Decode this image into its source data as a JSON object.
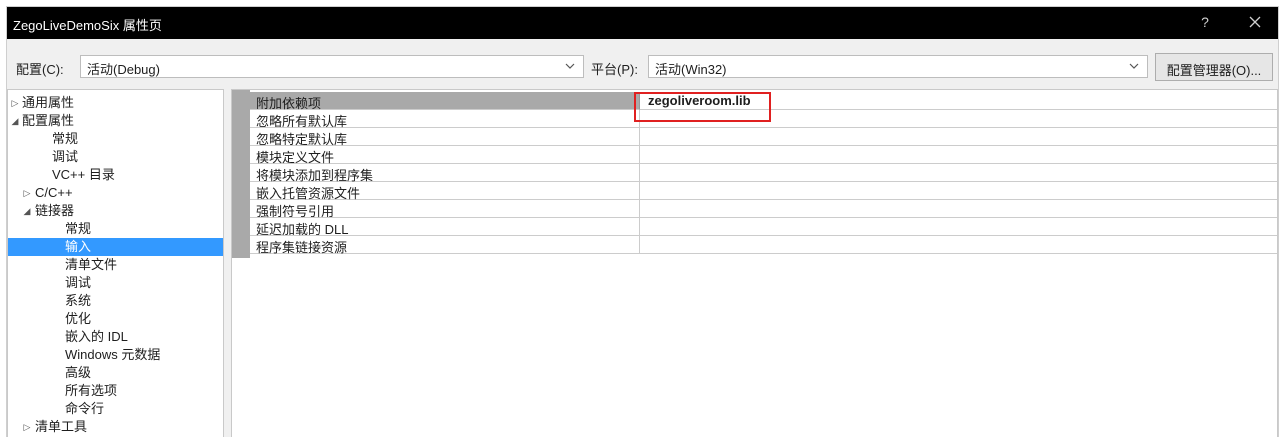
{
  "window": {
    "title": "ZegoLiveDemoSix 属性页",
    "help_label": "?",
    "close_icon": "close-icon"
  },
  "toolbar": {
    "config_label": "配置(C):",
    "config_value": "活动(Debug)",
    "platform_label": "平台(P):",
    "platform_value": "活动(Win32)",
    "config_manager_label": "配置管理器(O)..."
  },
  "tree": {
    "items": [
      {
        "label": "通用属性",
        "arrow": "▷"
      },
      {
        "label": "配置属性",
        "arrow": "◢"
      },
      {
        "label": "常规"
      },
      {
        "label": "调试"
      },
      {
        "label": "VC++ 目录"
      },
      {
        "label": "C/C++",
        "arrow": "▷"
      },
      {
        "label": "链接器",
        "arrow": "◢"
      },
      {
        "label": "常规"
      },
      {
        "label": "输入",
        "selected": true
      },
      {
        "label": "清单文件"
      },
      {
        "label": "调试"
      },
      {
        "label": "系统"
      },
      {
        "label": "优化"
      },
      {
        "label": "嵌入的 IDL"
      },
      {
        "label": "Windows 元数据"
      },
      {
        "label": "高级"
      },
      {
        "label": "所有选项"
      },
      {
        "label": "命令行"
      },
      {
        "label": "清单工具",
        "arrow": "▷"
      }
    ]
  },
  "properties": {
    "rows": [
      {
        "name": "附加依赖项",
        "value": "zegoliveroom.lib"
      },
      {
        "name": "忽略所有默认库",
        "value": ""
      },
      {
        "name": "忽略特定默认库",
        "value": ""
      },
      {
        "name": "模块定义文件",
        "value": ""
      },
      {
        "name": "将模块添加到程序集",
        "value": ""
      },
      {
        "name": "嵌入托管资源文件",
        "value": ""
      },
      {
        "name": "强制符号引用",
        "value": ""
      },
      {
        "name": "延迟加载的 DLL",
        "value": ""
      },
      {
        "name": "程序集链接资源",
        "value": ""
      }
    ]
  },
  "colors": {
    "titlebar": "#000000",
    "selection": "#3399ff",
    "highlight_box": "#e02020",
    "gutter": "#a9a9a9"
  }
}
